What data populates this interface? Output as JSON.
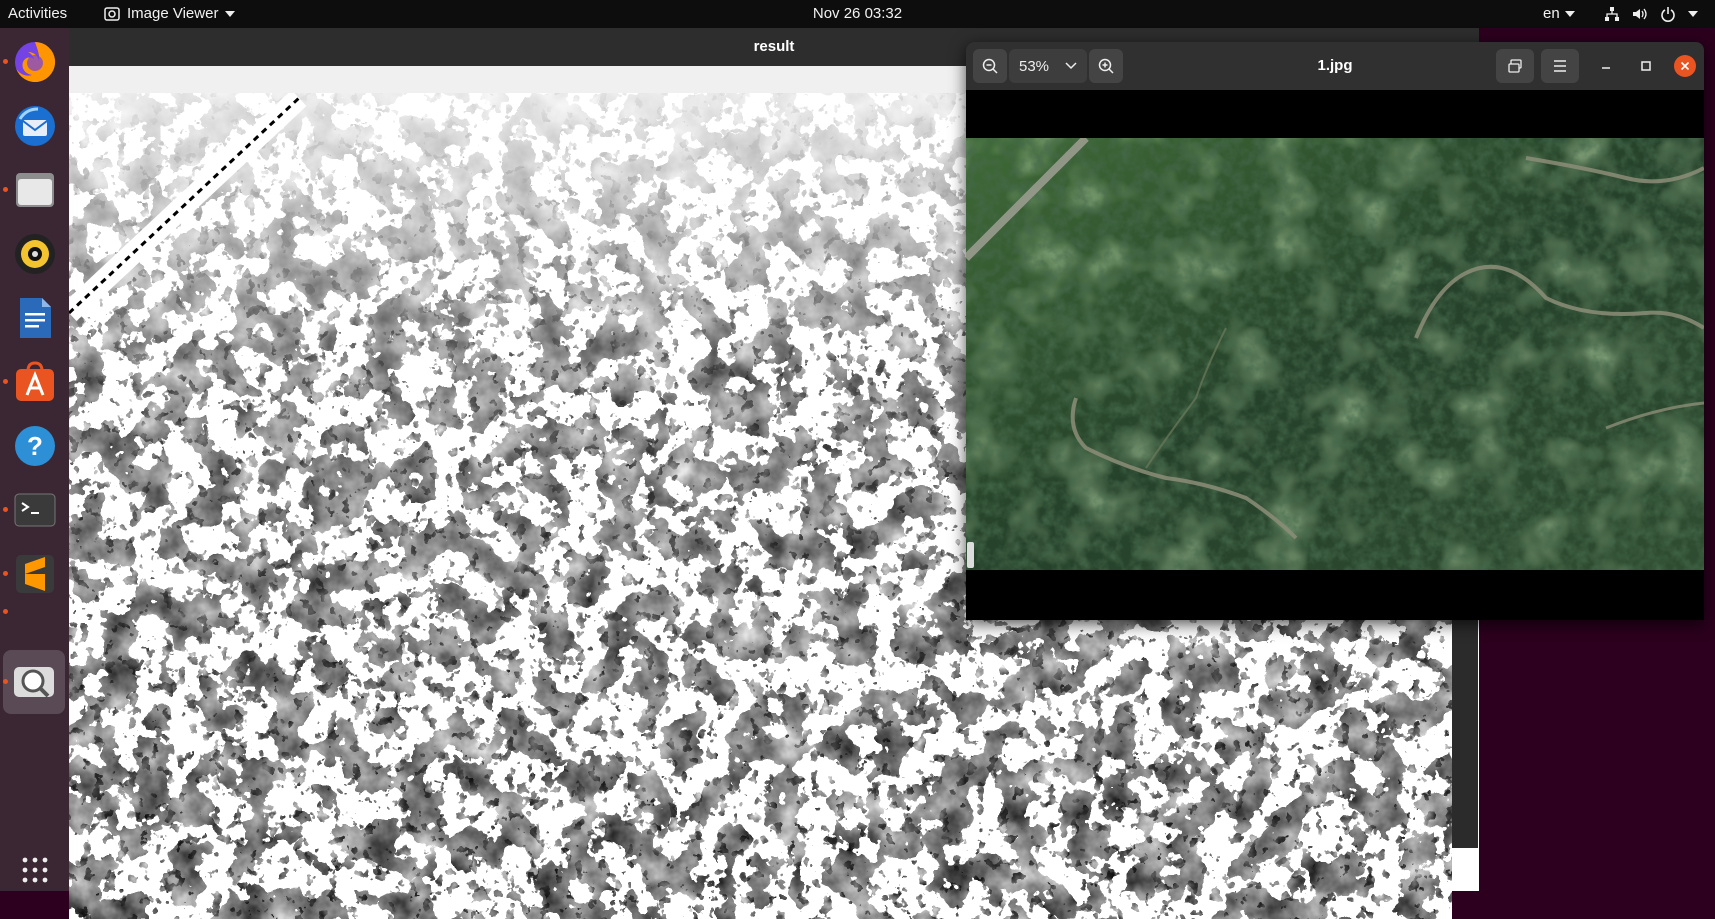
{
  "topbar": {
    "activities": "Activities",
    "app_name": "Image Viewer",
    "datetime": "Nov 26  03:32",
    "language": "en"
  },
  "dock": {
    "items": [
      {
        "name": "firefox",
        "icon": "firefox-icon",
        "running": true
      },
      {
        "name": "thunderbird",
        "icon": "thunderbird-icon",
        "running": false
      },
      {
        "name": "files",
        "icon": "files-icon",
        "running": true
      },
      {
        "name": "rhythmbox",
        "icon": "rhythmbox-icon",
        "running": false
      },
      {
        "name": "writer",
        "icon": "writer-icon",
        "running": false
      },
      {
        "name": "software",
        "icon": "software-icon",
        "running": true
      },
      {
        "name": "help",
        "icon": "help-icon",
        "running": false
      },
      {
        "name": "terminal",
        "icon": "terminal-icon",
        "running": true
      },
      {
        "name": "sublime",
        "icon": "sublime-icon",
        "running": true
      },
      {
        "name": "image-viewer",
        "icon": "image-viewer-icon",
        "running": true,
        "active": true
      }
    ],
    "apps_grid": "show-applications-icon"
  },
  "result_window": {
    "title": "result"
  },
  "viewer": {
    "zoom": "53%",
    "title": "1.jpg"
  },
  "colors": {
    "accent": "#e95420",
    "forest_dark": "#1f3322",
    "forest_light": "#4f7a3f",
    "road": "#8a8b74"
  }
}
